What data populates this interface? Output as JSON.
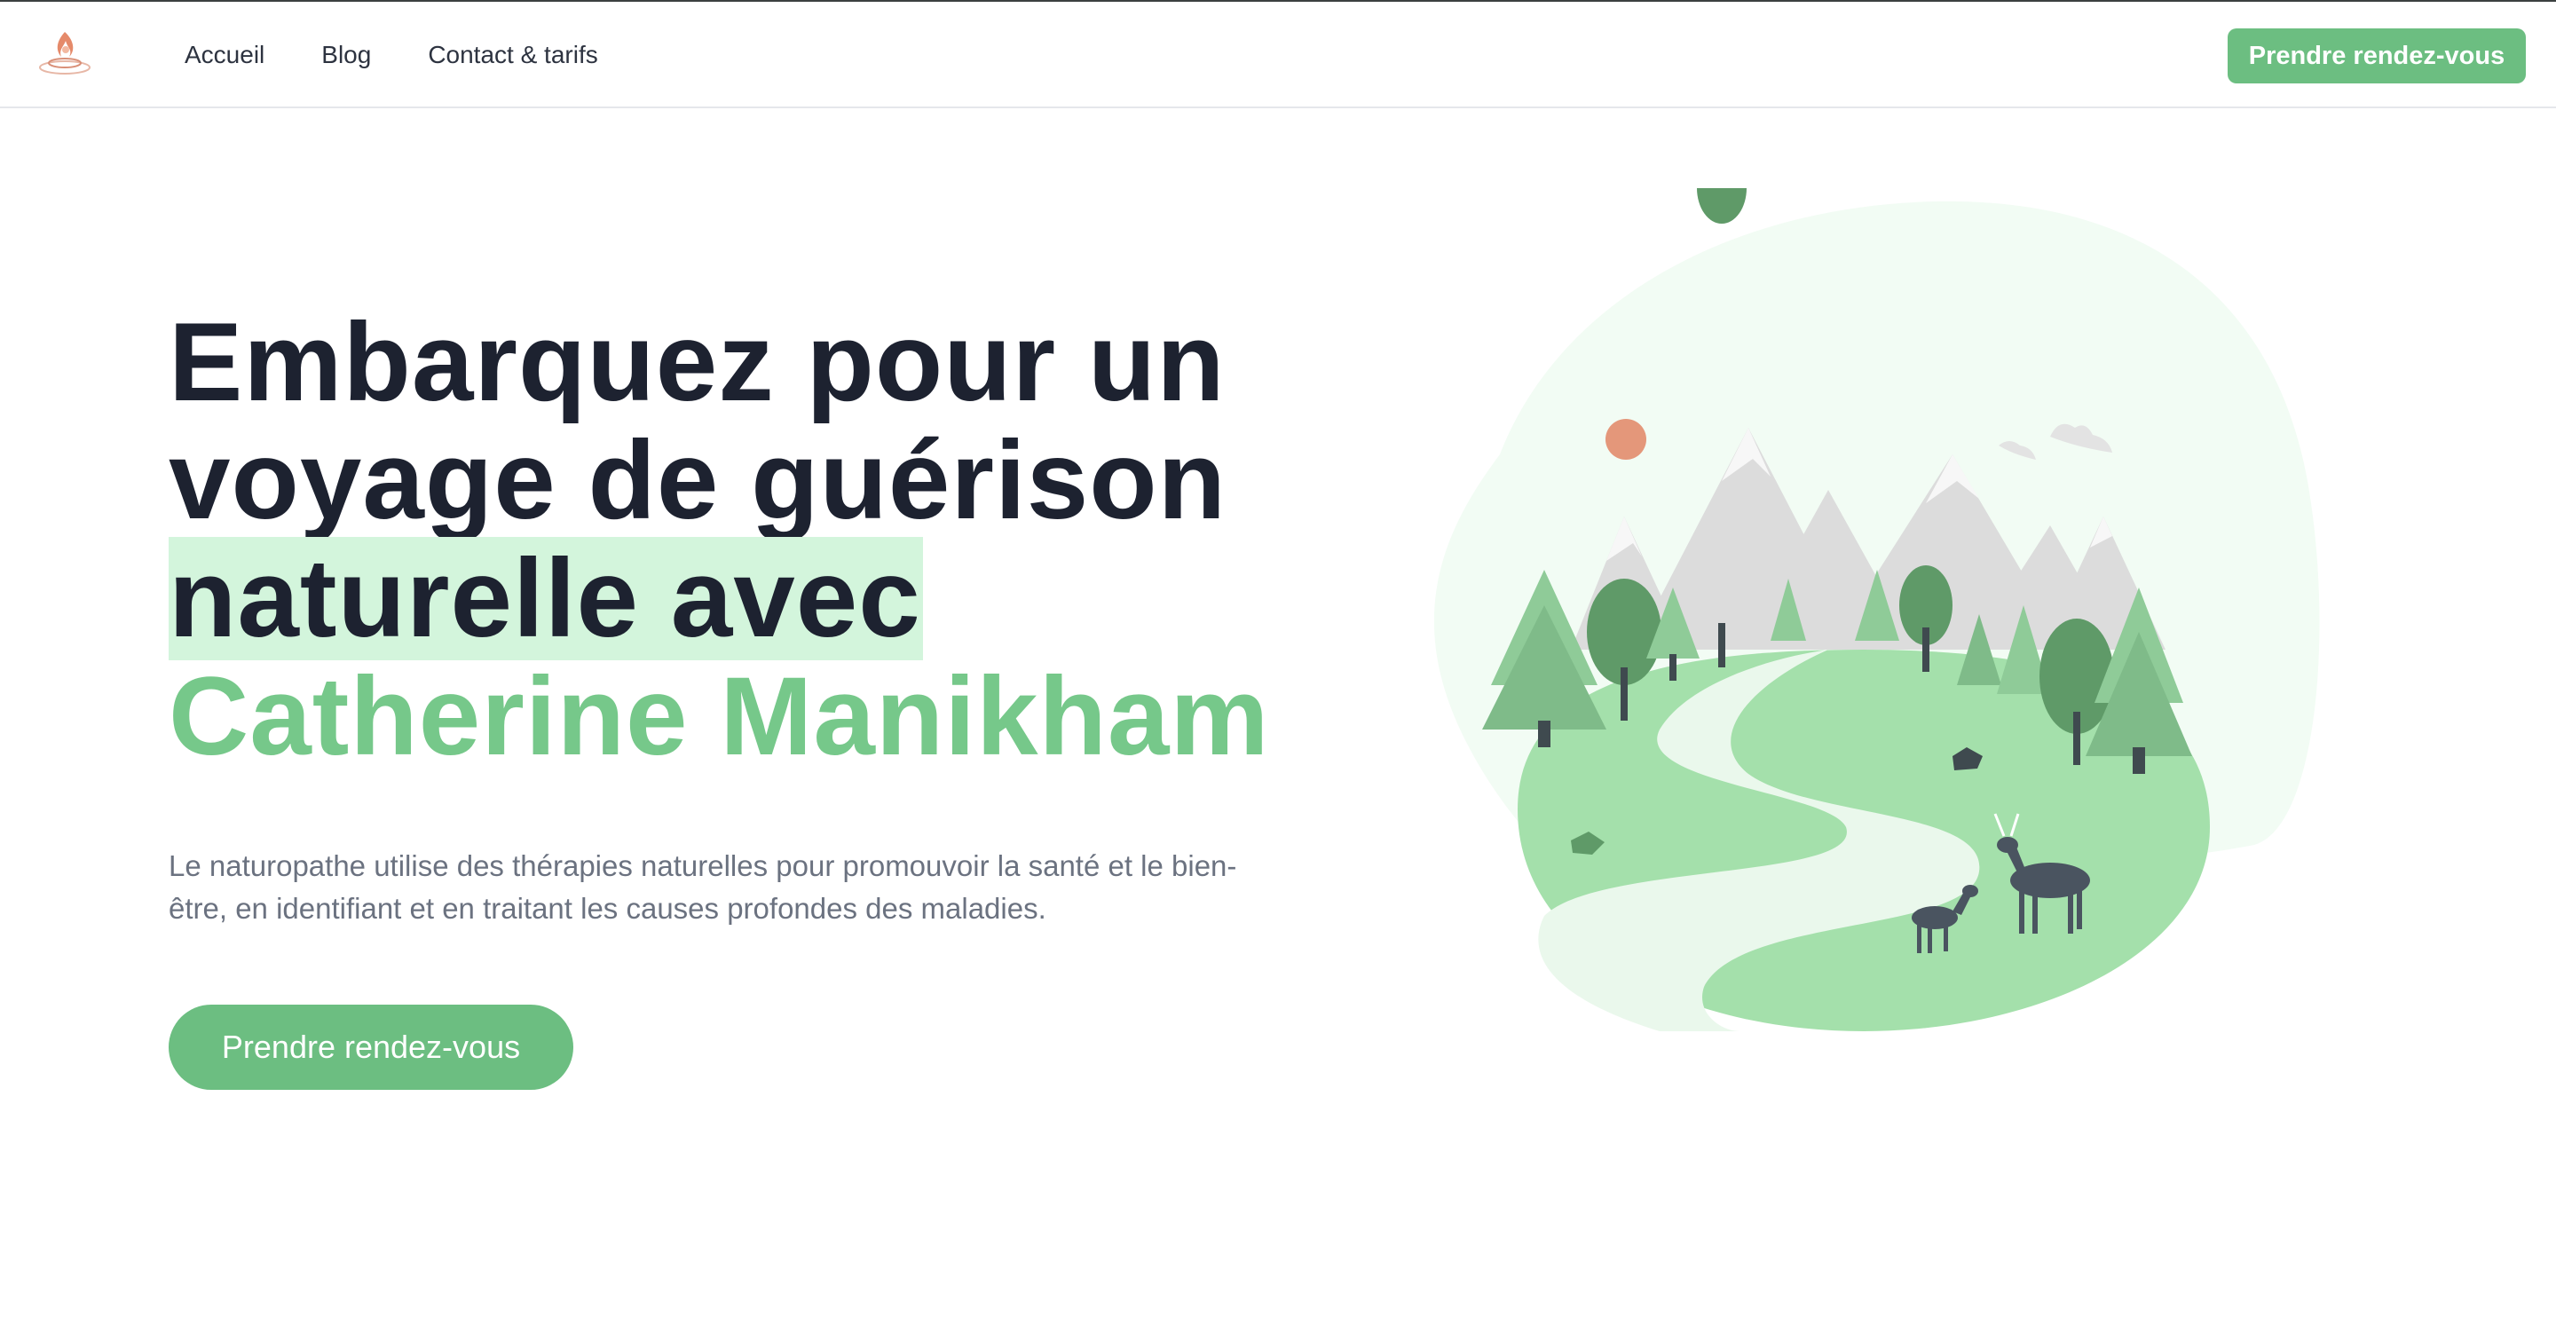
{
  "nav": {
    "items": [
      "Accueil",
      "Blog",
      "Contact & tarifs"
    ],
    "cta": "Prendre rendez-vous"
  },
  "hero": {
    "title_line1": "Embarquez pour un",
    "title_line2": "voyage de guérison",
    "title_line3": "naturelle avec",
    "title_name": "Catherine Manikham",
    "description": "Le naturopathe utilise des thérapies naturelles pour promouvoir la santé et le bien-être, en identifiant et en traitant les causes profondes des maladies.",
    "cta": "Prendre rendez-vous"
  },
  "colors": {
    "brand_green": "#6cbe81",
    "accent_text": "#76c88a",
    "highlight": "#d3f5dc",
    "heading": "#1d2230"
  },
  "icons": {
    "logo": "flame-logo-icon",
    "illustration": "forest-deer-landscape"
  }
}
